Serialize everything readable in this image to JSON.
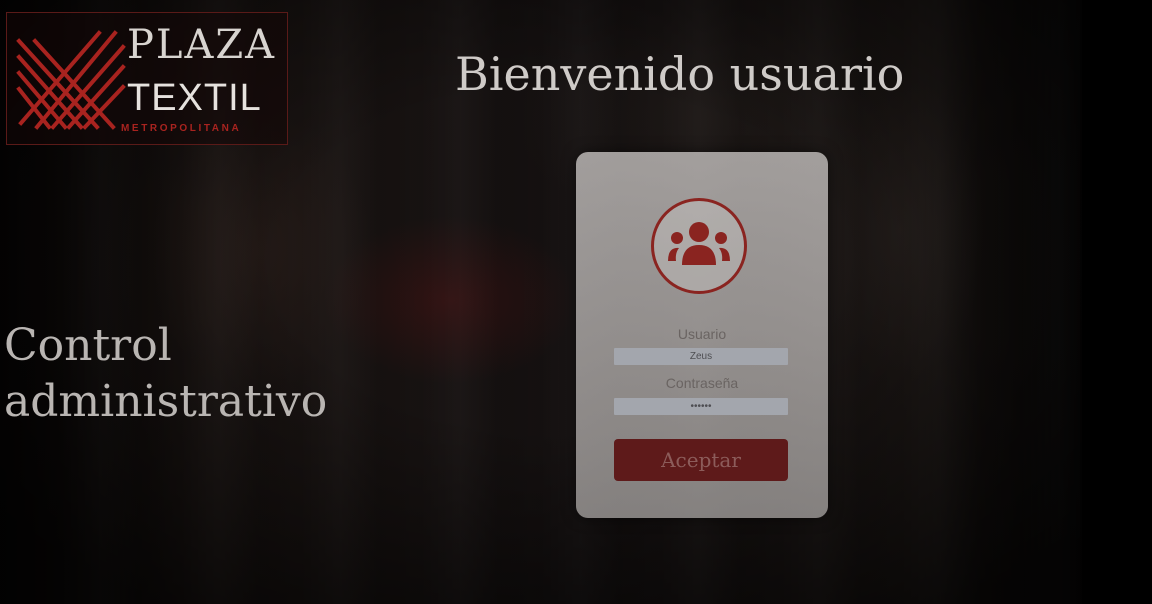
{
  "brand": {
    "word1": "PLAZA",
    "word2": "TEXTIL",
    "word3": "METROPOLITANA",
    "accent_color": "#a8231f"
  },
  "header": {
    "welcome": "Bienvenido usuario"
  },
  "hero": {
    "line1": "Control",
    "line2": "administrativo"
  },
  "login": {
    "avatar_icon": "users-group-icon",
    "username_label": "Usuario",
    "username_value": "Zeus",
    "password_label": "Contraseña",
    "password_value": "••••••",
    "submit_label": "Aceptar",
    "button_color": "#5e1a1a"
  }
}
